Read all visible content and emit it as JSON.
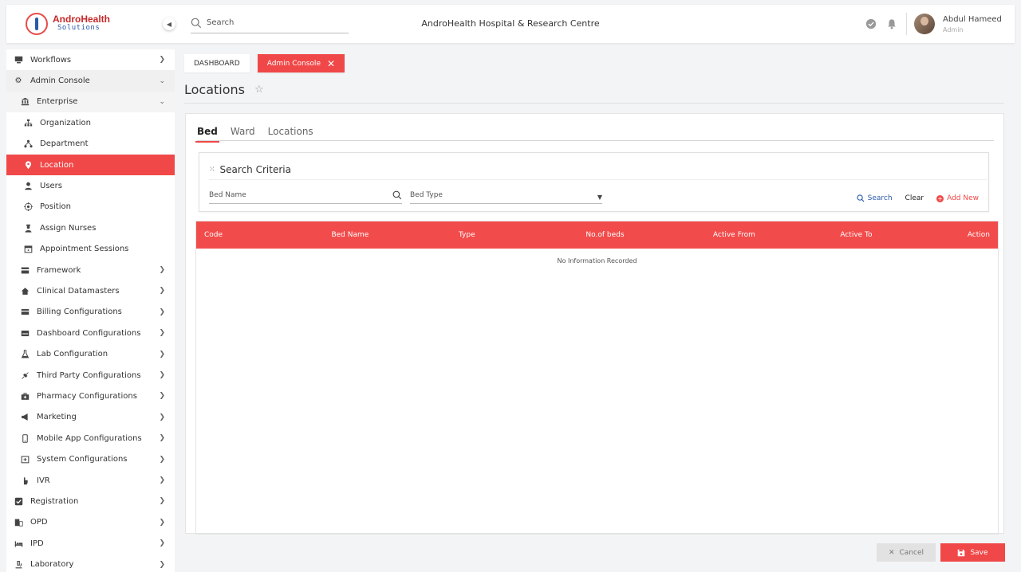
{
  "header": {
    "logo_title": "AndroHealth",
    "logo_subtitle": "Solutions",
    "search_placeholder": "Search",
    "hospital_name": "AndroHealth Hospital & Research Centre",
    "user_name": "Abdul Hameed",
    "user_role": "Admin"
  },
  "sidebar": {
    "items": [
      {
        "label": "Workflows",
        "icon": "monitor-icon"
      },
      {
        "label": "Admin Console",
        "icon": "gear-icon"
      },
      {
        "label": "Enterprise",
        "icon": "bank-icon"
      },
      {
        "label": "Organization",
        "icon": "org-chart-icon"
      },
      {
        "label": "Department",
        "icon": "hierarchy-icon"
      },
      {
        "label": "Location",
        "icon": "pin-icon"
      },
      {
        "label": "Users",
        "icon": "user-icon"
      },
      {
        "label": "Position",
        "icon": "target-icon"
      },
      {
        "label": "Assign Nurses",
        "icon": "nurse-icon"
      },
      {
        "label": "Appointment Sessions",
        "icon": "calendar-icon"
      },
      {
        "label": "Framework",
        "icon": "framework-icon"
      },
      {
        "label": "Clinical Datamasters",
        "icon": "home-icon"
      },
      {
        "label": "Billing Configurations",
        "icon": "card-icon"
      },
      {
        "label": "Dashboard Configurations",
        "icon": "dashboard-icon"
      },
      {
        "label": "Lab Configuration",
        "icon": "flask-icon"
      },
      {
        "label": "Third Party Configurations",
        "icon": "plug-icon"
      },
      {
        "label": "Pharmacy Configurations",
        "icon": "medkit-icon"
      },
      {
        "label": "Marketing",
        "icon": "megaphone-icon"
      },
      {
        "label": "Mobile App Configurations",
        "icon": "mobile-icon"
      },
      {
        "label": "System Configurations",
        "icon": "hospital-icon"
      },
      {
        "label": "IVR",
        "icon": "hand-icon"
      },
      {
        "label": "Registration",
        "icon": "checkbox-icon"
      },
      {
        "label": "OPD",
        "icon": "building-icon"
      },
      {
        "label": "IPD",
        "icon": "bed-icon"
      },
      {
        "label": "Laboratory",
        "icon": "microscope-icon"
      }
    ]
  },
  "breadcrumbs": {
    "dashboard": "DASHBOARD",
    "admin_console": "Admin Console"
  },
  "page": {
    "title": "Locations"
  },
  "tabs": [
    "Bed",
    "Ward",
    "Locations"
  ],
  "criteria": {
    "title": "Search Criteria",
    "bed_name_placeholder": "Bed Name",
    "bed_type_placeholder": "Bed Type",
    "search_label": "Search",
    "clear_label": "Clear",
    "add_new_label": "Add New"
  },
  "table": {
    "columns": [
      "Code",
      "Bed Name",
      "Type",
      "No.of beds",
      "Active From",
      "Active To",
      "Action"
    ],
    "empty_text": "No Information Recorded"
  },
  "footer": {
    "cancel_label": "Cancel",
    "save_label": "Save"
  },
  "colors": {
    "accent": "#f04848",
    "brand_blue": "#2b5aa8"
  }
}
